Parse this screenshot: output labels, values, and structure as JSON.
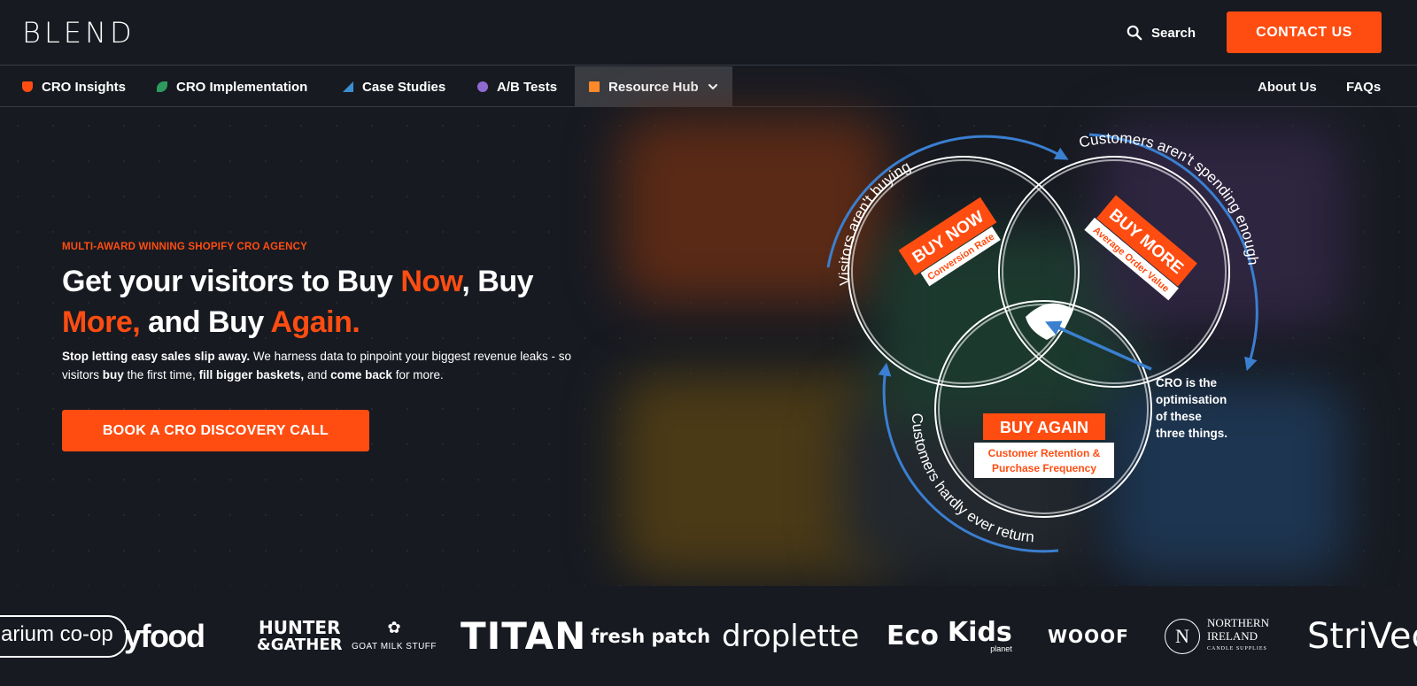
{
  "header": {
    "logo": "BLEND",
    "search_label": "Search",
    "contact_label": "CONTACT US"
  },
  "nav": {
    "items": [
      {
        "label": "CRO Insights",
        "icon": "shield-icon"
      },
      {
        "label": "CRO Implementation",
        "icon": "leaf-icon"
      },
      {
        "label": "Case Studies",
        "icon": "triangle-icon"
      },
      {
        "label": "A/B Tests",
        "icon": "dot-icon"
      },
      {
        "label": "Resource Hub",
        "icon": "square-icon"
      }
    ],
    "right": [
      "About Us",
      "FAQs"
    ]
  },
  "hero": {
    "eyebrow": "MULTI-AWARD WINNING SHOPIFY CRO AGENCY",
    "headline": {
      "p1": "Get your visitors to Buy ",
      "h1": "Now",
      "p2": ", Buy ",
      "h2": "More,",
      "p3": " and Buy ",
      "h3": "Again."
    },
    "subcopy": {
      "b1": "Stop letting easy sales slip away.",
      "t1": " We harness data to pinpoint your biggest revenue leaks - so visitors ",
      "b2": "buy",
      "t2": " the first time, ",
      "b3": "fill bigger baskets,",
      "t3": " and ",
      "b4": "come back",
      "t4": " for more."
    },
    "cta_label": "BOOK A CRO DISCOVERY CALL"
  },
  "diagram": {
    "arc_top_left": "Visitors aren't buying",
    "arc_top_right": "Customers aren't spending enough",
    "arc_bottom": "Customers hardly ever return",
    "buy_now": "BUY NOW",
    "buy_now_sub": "Conversion Rate",
    "buy_more": "BUY MORE",
    "buy_more_sub": "Average Order Value",
    "buy_again": "BUY AGAIN",
    "buy_again_sub1": "Customer Retention &",
    "buy_again_sub2": "Purchase Frequency",
    "cro_note": [
      "CRO is the",
      "optimisation",
      "of these",
      "three things."
    ],
    "colors": {
      "accent": "#ff4d12",
      "arrow": "#3a7fd0"
    }
  },
  "logos": [
    "arium co-op",
    "yfood",
    "HUNTER",
    "&GATHER",
    "GOAT MILK STUFF",
    "TITAN",
    "fresh patch",
    "droplette",
    "Eco",
    "Kids",
    "planet",
    "WOOOF",
    "NORTHERN",
    "IRELAND",
    "CANDLE SUPPLIES",
    "StriVec"
  ]
}
